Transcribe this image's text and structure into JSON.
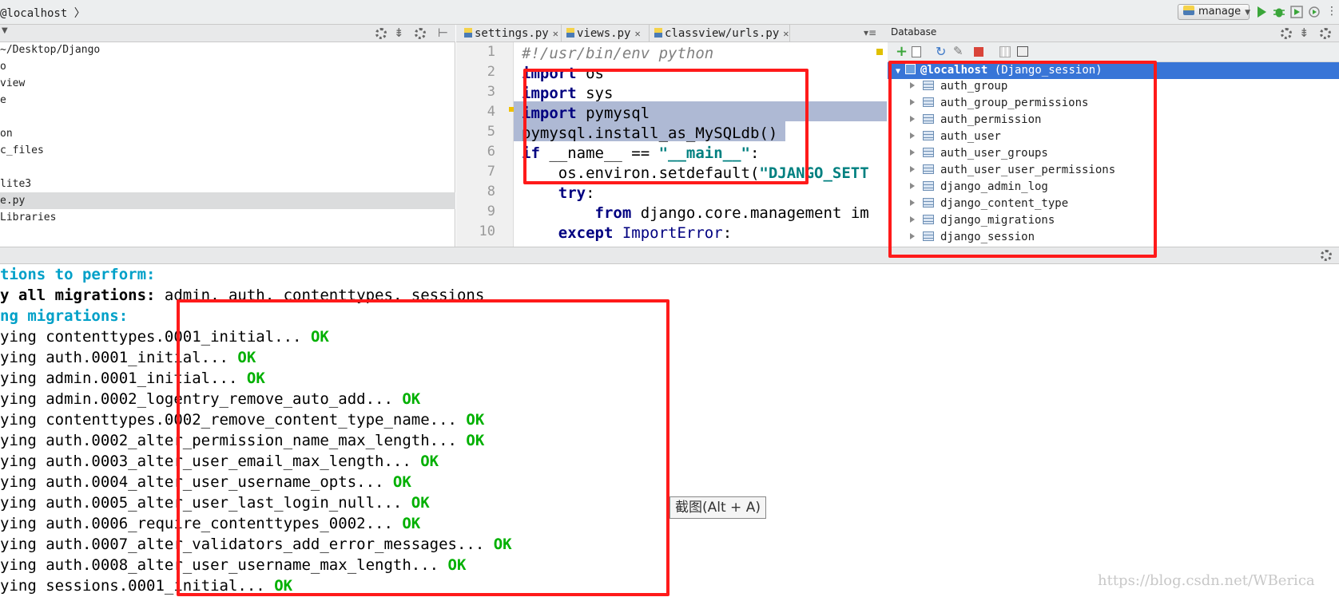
{
  "navbar": {
    "breadcrumb": "@localhost 〉",
    "run_config": "manage"
  },
  "project": {
    "rows": [
      {
        "text": "~/Desktop/Django",
        "selected": false
      },
      {
        "text": "o",
        "selected": false
      },
      {
        "text": "view",
        "selected": false
      },
      {
        "text": "e",
        "selected": false
      },
      {
        "text": "",
        "selected": false
      },
      {
        "text": "on",
        "selected": false
      },
      {
        "text": "c_files",
        "selected": false
      },
      {
        "text": "",
        "selected": false
      },
      {
        "text": "lite3",
        "selected": false
      },
      {
        "text": "e.py",
        "selected": true
      },
      {
        "text": " Libraries",
        "selected": false
      }
    ]
  },
  "tabs": [
    {
      "label": "settings.py"
    },
    {
      "label": "views.py"
    },
    {
      "label": "classview/urls.py"
    }
  ],
  "editor": {
    "line_numbers": [
      "1",
      "2",
      "3",
      "4",
      "5",
      "6",
      "7",
      "8",
      "9",
      "10"
    ],
    "lines": [
      "#!/usr/bin/env python",
      "import os",
      "import sys",
      "import pymysql",
      "pymysql.install_as_MySQLdb()",
      "if __name__ == \"__main__\":",
      "    os.environ.setdefault(\"DJANGO_SETT",
      "    try:",
      "        from django.core.management im",
      "    except ImportError:"
    ]
  },
  "database": {
    "title": "Database",
    "root_label": "@localhost",
    "root_schema": "(Django_session)",
    "tables": [
      "auth_group",
      "auth_group_permissions",
      "auth_permission",
      "auth_user",
      "auth_user_groups",
      "auth_user_user_permissions",
      "django_admin_log",
      "django_content_type",
      "django_migrations",
      "django_session"
    ]
  },
  "console": {
    "header1": "tions to perform:",
    "header2_bold": "y all migrations:",
    "header2_rest": " admin, auth, contenttypes, sessions",
    "header3": "ng migrations:",
    "prefix": "ying ",
    "ok": "OK",
    "migrations": [
      "contenttypes.0001_initial... ",
      "auth.0001_initial... ",
      "admin.0001_initial... ",
      "admin.0002_logentry_remove_auto_add... ",
      "contenttypes.0002_remove_content_type_name... ",
      "auth.0002_alter_permission_name_max_length... ",
      "auth.0003_alter_user_email_max_length... ",
      "auth.0004_alter_user_username_opts... ",
      "auth.0005_alter_user_last_login_null... ",
      "auth.0006_require_contenttypes_0002... ",
      "auth.0007_alter_validators_add_error_messages... ",
      "auth.0008_alter_user_username_max_length... ",
      "sessions.0001_initial... "
    ]
  },
  "tooltip": "截图(Alt + A)",
  "watermark": "https://blog.csdn.net/WBerica",
  "colors": {
    "annotation_red": "#ff1a1a",
    "selection_blue": "#3875d7",
    "ok_green": "#00b000",
    "header_cyan": "#00a0c8"
  }
}
